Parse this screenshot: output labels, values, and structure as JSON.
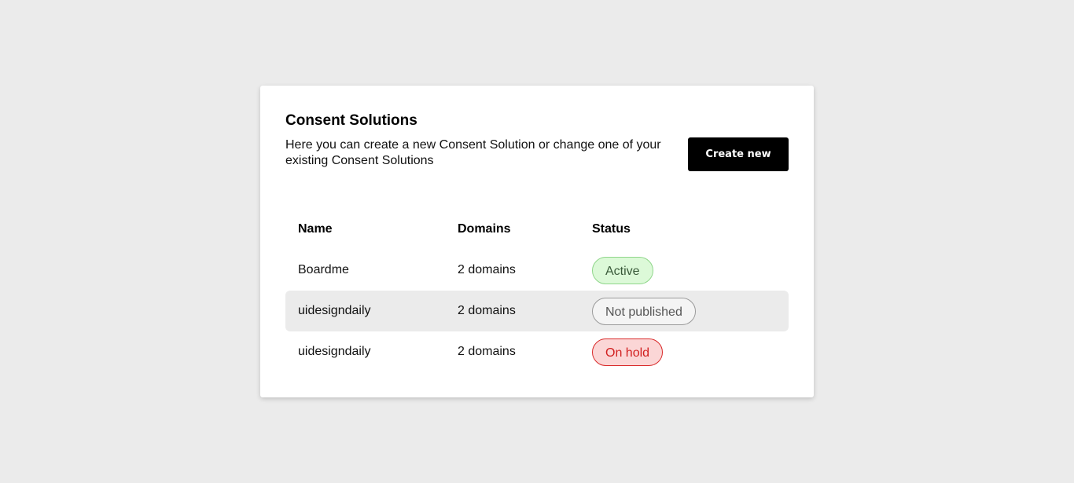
{
  "header": {
    "title": "Consent Solutions",
    "description": "Here you can create a new Consent Solution or change one of your existing Consent Solutions",
    "create_button": "Create new"
  },
  "table": {
    "columns": [
      "Name",
      "Domains",
      "Status"
    ],
    "rows": [
      {
        "name": "Boardme",
        "domains": "2 domains",
        "status": "Active"
      },
      {
        "name": "uidesigndaily",
        "domains": "2 domains",
        "status": "Not published"
      },
      {
        "name": "uidesigndaily",
        "domains": "2 domains",
        "status": "On hold"
      }
    ]
  },
  "colors": {
    "page_background": "#ebebeb",
    "button": "#000000",
    "active": "#dcf9d8",
    "not_published": "#f4f4f4",
    "on_hold": "#fbd6d6"
  }
}
